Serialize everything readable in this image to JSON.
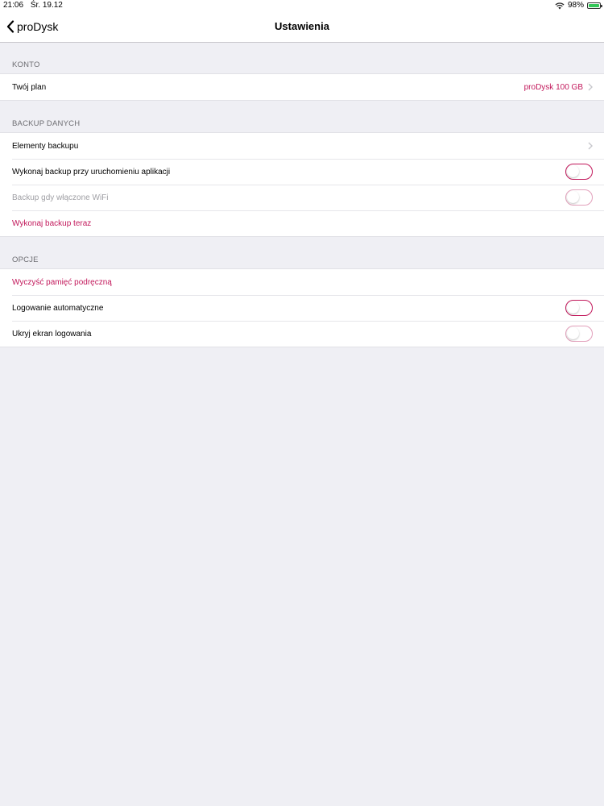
{
  "status_bar": {
    "time": "21:06",
    "date": "Śr. 19.12",
    "battery": "98%",
    "battery_level": 0.98
  },
  "nav": {
    "back_label": "proDysk",
    "title": "Ustawienia"
  },
  "sections": {
    "account": {
      "header": "KONTO",
      "plan_label": "Twój plan",
      "plan_value": "proDysk 100 GB"
    },
    "backup": {
      "header": "BACKUP DANYCH",
      "items_label": "Elementy backupu",
      "on_launch_label": "Wykonaj backup przy uruchomieniu aplikacji",
      "on_launch_enabled": false,
      "wifi_label": "Backup gdy włączone WiFi",
      "wifi_enabled": false,
      "wifi_disabled_row": true,
      "now_label": "Wykonaj backup teraz"
    },
    "options": {
      "header": "OPCJE",
      "clear_cache_label": "Wyczyść pamięć podręczną",
      "auto_login_label": "Logowanie automatyczne",
      "auto_login_enabled": false,
      "hide_login_label": "Ukryj ekran logowania",
      "hide_login_enabled": false
    }
  },
  "colors": {
    "accent": "#c2185b",
    "background": "#efeff4",
    "battery_fill": "#34c759"
  },
  "icons": {
    "back": "chevron-left-icon",
    "disclosure": "chevron-right-icon",
    "wifi": "wifi-icon",
    "battery": "battery-icon"
  }
}
